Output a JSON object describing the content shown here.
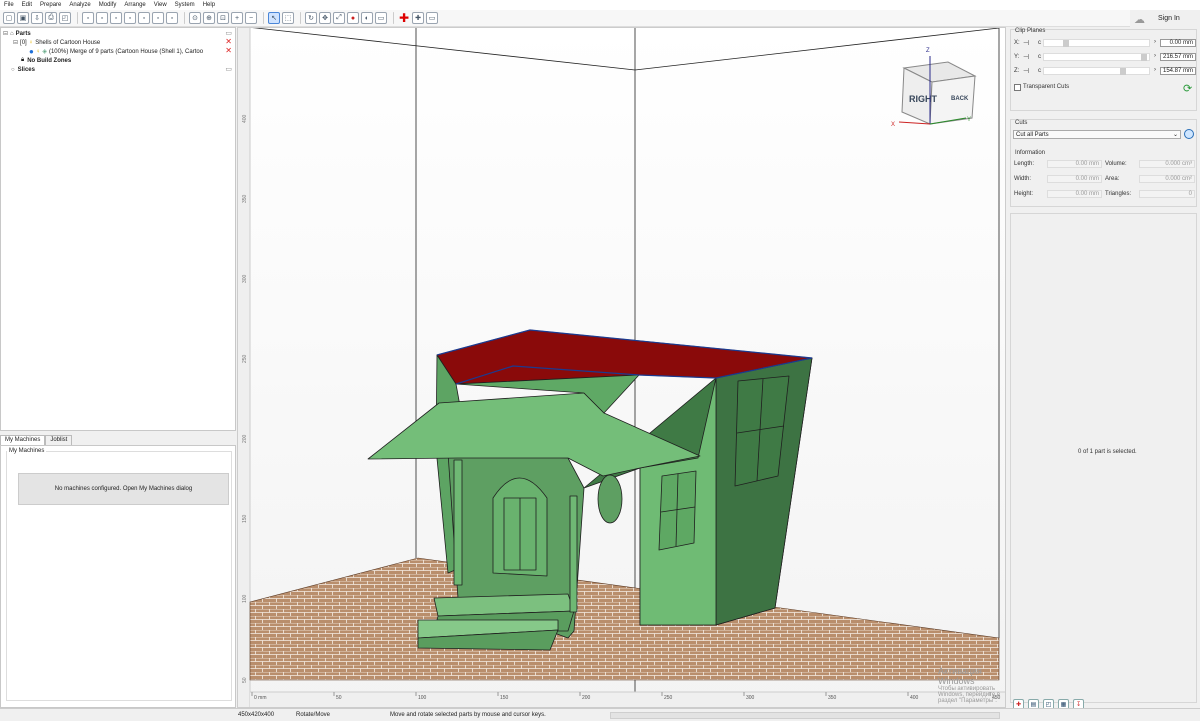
{
  "menu": [
    "File",
    "Edit",
    "Prepare",
    "Analyze",
    "Modify",
    "Arrange",
    "View",
    "System",
    "Help"
  ],
  "toolbar": {
    "icons": [
      "new-icon",
      "save-icon",
      "import-icon",
      "print-icon",
      "screenshot-icon",
      "sep",
      "view-front-icon",
      "view-back-icon",
      "view-left-icon",
      "view-right-icon",
      "view-top-icon",
      "view-bottom-icon",
      "view-iso-icon",
      "sep",
      "zoom-fit-icon",
      "zoom-all-icon",
      "zoom-window-icon",
      "zoom-in-icon",
      "zoom-out-icon",
      "sep",
      "select-cursor-icon",
      "select-box-icon",
      "sep",
      "rotate-view-icon",
      "pan-view-icon",
      "fit-view-icon",
      "color-by-icon",
      "shading-icon",
      "camera-icon",
      "sep",
      "add-icon",
      "repair-icon",
      "measure-icon"
    ],
    "signin_label": "Sign In"
  },
  "parts": {
    "root_label": "Parts",
    "shell_label": "Shells of Cartoon House",
    "shell_index": "[0]",
    "merge_label": "(100%) Merge of 9 parts (Cartoon House (Shell 1), Cartoo",
    "nbz_label": "No Build Zones",
    "slices_label": "Slices"
  },
  "machines": {
    "tabs": [
      "My Machines",
      "Joblist"
    ],
    "group_label": "My Machines",
    "message": "No machines configured. Open My Machines dialog"
  },
  "viewport": {
    "x_ticks": [
      "0 mm",
      "50",
      "100",
      "150",
      "200",
      "250",
      "300",
      "350",
      "400",
      "450"
    ],
    "y_ticks": [
      "400",
      "350",
      "300",
      "250",
      "200",
      "150",
      "100",
      "50"
    ],
    "navcube": {
      "right": "RIGHT",
      "back": "BACK",
      "z": "Z",
      "x": "X",
      "y": "Y"
    },
    "watermark_title": "Активация Windows",
    "watermark_text": "Чтобы активировать Windows, перейдите в раздел \"Параметры\"."
  },
  "clip_planes": {
    "title": "Clip Planes",
    "rows": [
      {
        "axis": "X:",
        "c": "c",
        "value": "0.00 mm",
        "level": 0.18
      },
      {
        "axis": "Y:",
        "c": "c",
        "value": "216.57 mm",
        "level": 0.92
      },
      {
        "axis": "Z:",
        "c": "c",
        "value": "154.87 mm",
        "level": 0.72
      }
    ],
    "transparent_label": "Transparent Cuts"
  },
  "cuts": {
    "title": "Cuts",
    "select_value": "Cut all Parts"
  },
  "information": {
    "title": "Information",
    "left": [
      {
        "label": "Length:",
        "value": "0.00 mm"
      },
      {
        "label": "Width:",
        "value": "0.00 mm"
      },
      {
        "label": "Height:",
        "value": "0.00 mm"
      }
    ],
    "right": [
      {
        "label": "Volume:",
        "value": "0.000 cm³"
      },
      {
        "label": "Area:",
        "value": "0.000 cm²"
      },
      {
        "label": "Triangles:",
        "value": "0"
      }
    ],
    "selection_status": "0 of 1 part is selected."
  },
  "status": {
    "dims": "450x420x400",
    "mode": "Rotate/Move",
    "hint": "Move and rotate selected parts by mouse and cursor keys."
  },
  "colors": {
    "model_green": "#6fbb74",
    "model_dark": "#3f7a45",
    "interior_red": "#8a0a0a",
    "platform": "#b38a6a"
  }
}
